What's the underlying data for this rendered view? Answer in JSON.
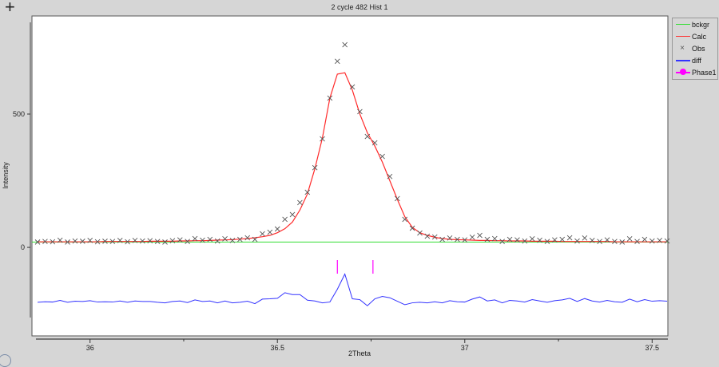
{
  "toolbar": {
    "pan_icon": "crosshair-move-icon"
  },
  "chart_data": {
    "type": "scatter",
    "title": "2 cycle 482 Hist 1",
    "xlabel": "2Theta",
    "ylabel": "Intensity",
    "xlim": [
      35.845,
      37.542
    ],
    "ylim": [
      -332,
      868
    ],
    "xticks": [
      36,
      36.5,
      37,
      37.5
    ],
    "xtick_labels": [
      "36",
      "36.5",
      "37",
      "37.5"
    ],
    "xminor_ticks": [
      36.25,
      36.75,
      37.25
    ],
    "yticks": [
      0,
      500
    ],
    "ytick_labels": [
      "0",
      "500"
    ],
    "x_start": 35.86,
    "x_step": 0.02,
    "background": 20,
    "diff_offset": -205,
    "series": [
      {
        "name": "Obs",
        "color": "#555555",
        "marker": "x",
        "values": [
          20,
          22,
          21,
          27,
          20,
          24,
          23,
          26,
          21,
          23,
          22,
          26,
          21,
          26,
          24,
          25,
          22,
          20,
          25,
          28,
          22,
          33,
          27,
          30,
          24,
          32,
          26,
          30,
          36,
          30,
          51,
          57,
          69,
          105,
          123,
          168,
          207,
          299,
          407,
          560,
          698,
          760,
          602,
          509,
          416,
          392,
          341,
          266,
          183,
          105,
          72,
          54,
          42,
          39,
          30,
          35,
          30,
          28,
          38,
          45,
          30,
          33,
          22,
          30,
          28,
          24,
          32,
          27,
          22,
          28,
          30,
          36,
          24,
          35,
          26,
          22,
          28,
          22,
          20,
          32,
          22,
          30,
          24,
          26,
          24
        ]
      },
      {
        "name": "Calc",
        "color": "#ff2a2a",
        "values": [
          21,
          21,
          21,
          21,
          21,
          21,
          21,
          21,
          21,
          22,
          22,
          22,
          22,
          22,
          22,
          23,
          23,
          23,
          23,
          24,
          24,
          25,
          25,
          26,
          27,
          28,
          29,
          31,
          33,
          36,
          40,
          45,
          55,
          70,
          95,
          140,
          200,
          295,
          410,
          560,
          650,
          655,
          590,
          500,
          430,
          380,
          320,
          250,
          180,
          115,
          75,
          55,
          45,
          38,
          33,
          30,
          29,
          28,
          27,
          26,
          26,
          25,
          25,
          24,
          24,
          24,
          23,
          23,
          23,
          23,
          22,
          22,
          22,
          22,
          22,
          22,
          22,
          21,
          21,
          21,
          21,
          21,
          21,
          21,
          21
        ]
      },
      {
        "name": "bckgr",
        "color": "#33dd33"
      },
      {
        "name": "diff",
        "color": "#3333ff"
      },
      {
        "name": "Phase1",
        "color": "#ff00ff",
        "reflections": [
          36.66,
          36.755
        ]
      }
    ],
    "legend": {
      "position": "outside-right",
      "entries": [
        "bckgr",
        "Calc",
        "Obs",
        "diff",
        "Phase1"
      ]
    }
  }
}
